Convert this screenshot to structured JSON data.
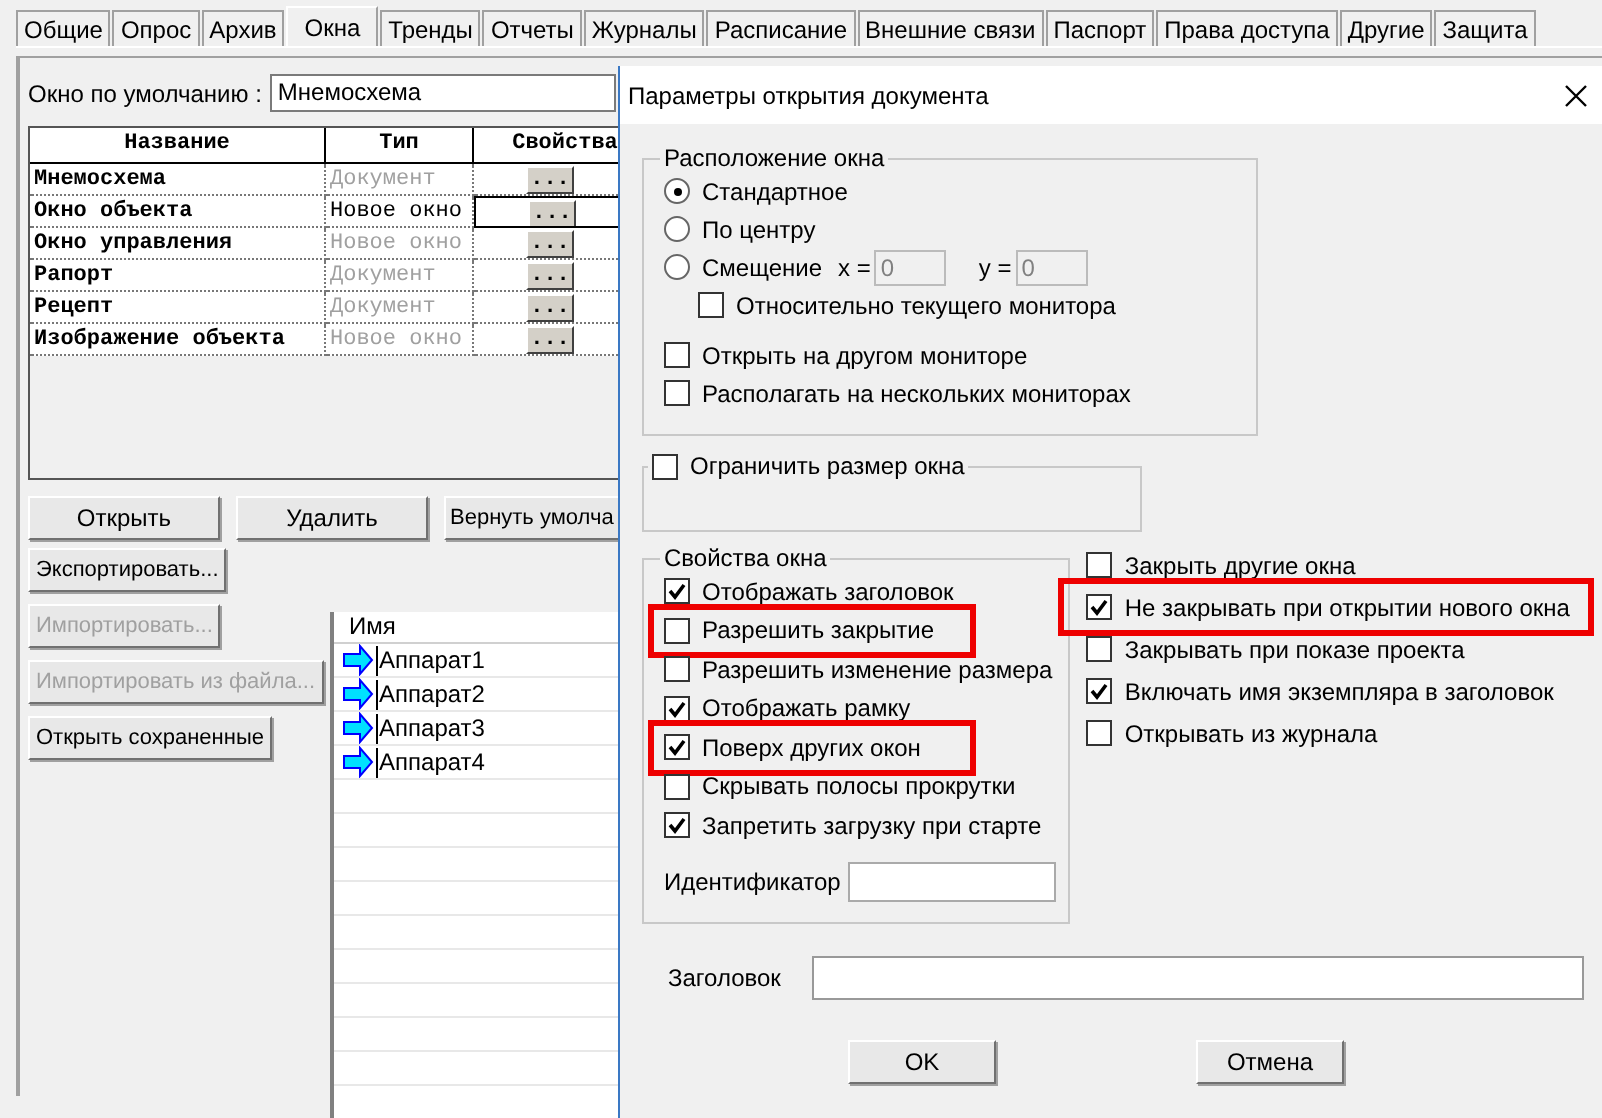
{
  "tabs": [
    {
      "label": "Общие",
      "selected": false
    },
    {
      "label": "Опрос",
      "selected": false
    },
    {
      "label": "Архив",
      "selected": false
    },
    {
      "label": "Окна",
      "selected": true
    },
    {
      "label": "Тренды",
      "selected": false
    },
    {
      "label": "Отчеты",
      "selected": false
    },
    {
      "label": "Журналы",
      "selected": false
    },
    {
      "label": "Расписание",
      "selected": false
    },
    {
      "label": "Внешние связи",
      "selected": false
    },
    {
      "label": "Паспорт",
      "selected": false
    },
    {
      "label": "Права доступа",
      "selected": false
    },
    {
      "label": "Другие",
      "selected": false
    },
    {
      "label": "Защита",
      "selected": false
    }
  ],
  "default_window": {
    "label": "Окно по умолчанию :",
    "value": "Мнемосхема"
  },
  "table": {
    "columns": [
      "Название",
      "Тип",
      "Свойства"
    ],
    "rows": [
      {
        "name": "Мнемосхема",
        "type": "Документ",
        "button": "...",
        "selected": false
      },
      {
        "name": "Окно объекта",
        "type": "Новое окно",
        "button": "...",
        "selected": true
      },
      {
        "name": "Окно управления",
        "type": "Новое окно",
        "button": "...",
        "selected": false
      },
      {
        "name": "Рапорт",
        "type": "Документ",
        "button": "...",
        "selected": false
      },
      {
        "name": "Рецепт",
        "type": "Документ",
        "button": "...",
        "selected": false
      },
      {
        "name": "Изображение объекта",
        "type": "Новое окно",
        "button": "...",
        "selected": false
      }
    ]
  },
  "action_buttons": [
    {
      "label": "Открыть",
      "disabled": false
    },
    {
      "label": "Удалить",
      "disabled": false
    },
    {
      "label": "Вернуть умолча",
      "disabled": false
    }
  ],
  "side_buttons": [
    {
      "label": "Экспортировать...",
      "disabled": false
    },
    {
      "label": "Импортировать...",
      "disabled": true
    },
    {
      "label": "Импортировать из файла...",
      "disabled": true
    },
    {
      "label": "Открыть сохраненные",
      "disabled": false
    }
  ],
  "list": {
    "column": "Имя",
    "items": [
      "Аппарат1",
      "Аппарат2",
      "Аппарат3",
      "Аппарат4"
    ]
  },
  "dialog": {
    "title": "Параметры открытия документа",
    "position_group": {
      "title": "Расположение окна",
      "options": [
        {
          "label": "Стандартное",
          "selected": true
        },
        {
          "label": "По центру",
          "selected": false
        },
        {
          "label": "Смещение",
          "selected": false,
          "fields": [
            {
              "label": "x =",
              "value": "0",
              "disabled": true
            },
            {
              "label": "y =",
              "value": "0",
              "disabled": true
            }
          ]
        }
      ],
      "sub_checkbox": {
        "label": "Относительно текущего монитора",
        "checked": false
      },
      "checkboxes": [
        {
          "label": "Открыть на другом мониторе",
          "checked": false
        },
        {
          "label": "Располагать на нескольких мониторах",
          "checked": false
        }
      ]
    },
    "size_group": {
      "label": "Ограничить размер окна",
      "checked": false
    },
    "properties_group": {
      "title": "Свойства окна",
      "checkboxes": [
        {
          "label": "Отображать заголовок",
          "checked": true,
          "highlighted": false
        },
        {
          "label": "Разрешить закрытие",
          "checked": false,
          "highlighted": true
        },
        {
          "label": "Разрешить изменение размера",
          "checked": false,
          "highlighted": false
        },
        {
          "label": "Отображать рамку",
          "checked": true,
          "highlighted": false
        },
        {
          "label": "Поверх других окон",
          "checked": true,
          "highlighted": true
        },
        {
          "label": "Скрывать полосы прокрутки",
          "checked": false,
          "highlighted": false
        },
        {
          "label": "Запретить загрузку при старте",
          "checked": true,
          "highlighted": false
        }
      ],
      "id_field": {
        "label": "Идентификатор"
      }
    },
    "right_checkboxes": [
      {
        "label": "Закрыть другие окна",
        "checked": false,
        "highlighted": false
      },
      {
        "label": "Не закрывать при открытии нового окна",
        "checked": true,
        "highlighted": true
      },
      {
        "label": "Закрывать при показе проекта",
        "checked": false,
        "highlighted": false
      },
      {
        "label": "Включать имя экземпляра в заголовок",
        "checked": true,
        "highlighted": false
      },
      {
        "label": "Открывать из журнала",
        "checked": false,
        "highlighted": false
      }
    ],
    "caption_field": {
      "label": "Заголовок"
    },
    "buttons": [
      "OK",
      "Отмена"
    ]
  }
}
